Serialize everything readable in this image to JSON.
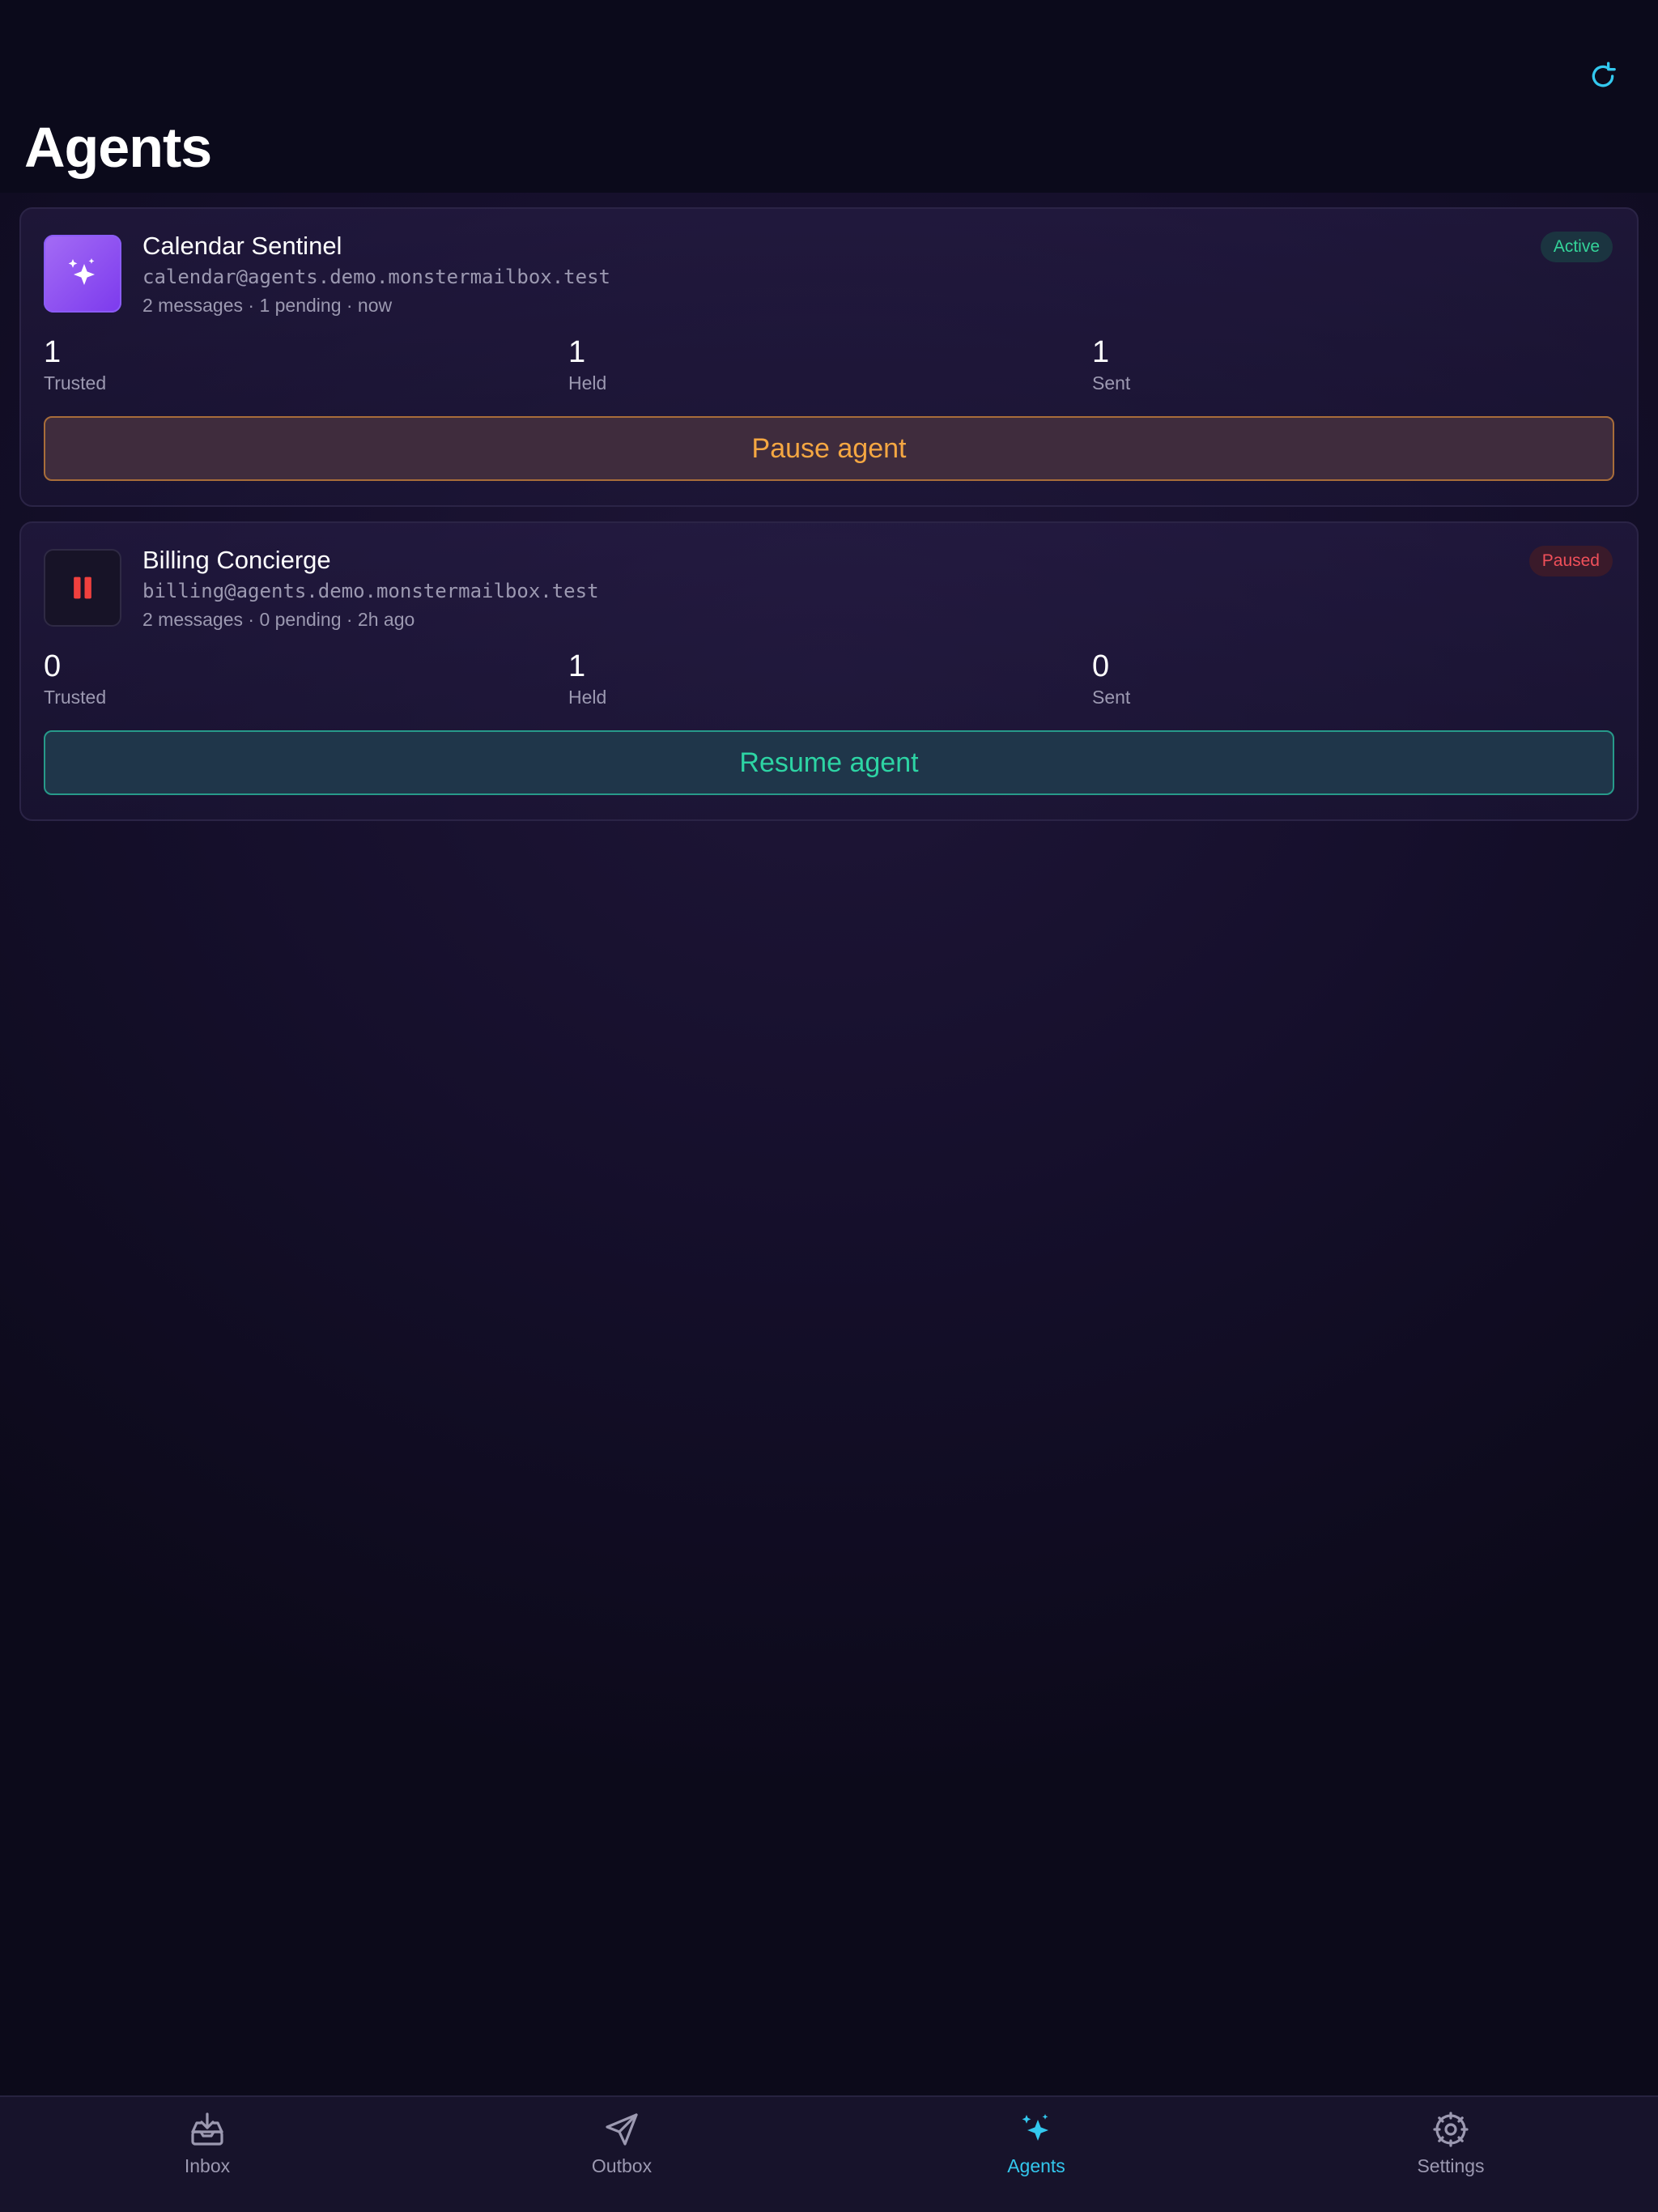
{
  "header": {
    "title": "Agents"
  },
  "colors": {
    "accent": "#33c8ee",
    "active": "#34d399",
    "paused": "#f0505a",
    "pause_action": "#f5a742",
    "resume_action": "#2dd4a4"
  },
  "agents": [
    {
      "name": "Calendar Sentinel",
      "email": "calendar@agents.demo.monstermailbox.test",
      "meta": "2 messages · 1 pending · now",
      "status": "Active",
      "icon": "sparkles-icon",
      "stats": [
        {
          "value": "1",
          "label": "Trusted"
        },
        {
          "value": "1",
          "label": "Held"
        },
        {
          "value": "1",
          "label": "Sent"
        }
      ],
      "action": "Pause agent"
    },
    {
      "name": "Billing Concierge",
      "email": "billing@agents.demo.monstermailbox.test",
      "meta": "2 messages · 0 pending · 2h ago",
      "status": "Paused",
      "icon": "pause-icon",
      "stats": [
        {
          "value": "0",
          "label": "Trusted"
        },
        {
          "value": "1",
          "label": "Held"
        },
        {
          "value": "0",
          "label": "Sent"
        }
      ],
      "action": "Resume agent"
    }
  ],
  "tabs": [
    {
      "label": "Inbox",
      "icon": "inbox-icon"
    },
    {
      "label": "Outbox",
      "icon": "send-icon"
    },
    {
      "label": "Agents",
      "icon": "sparkles-icon",
      "selected": true
    },
    {
      "label": "Settings",
      "icon": "gear-icon"
    }
  ]
}
